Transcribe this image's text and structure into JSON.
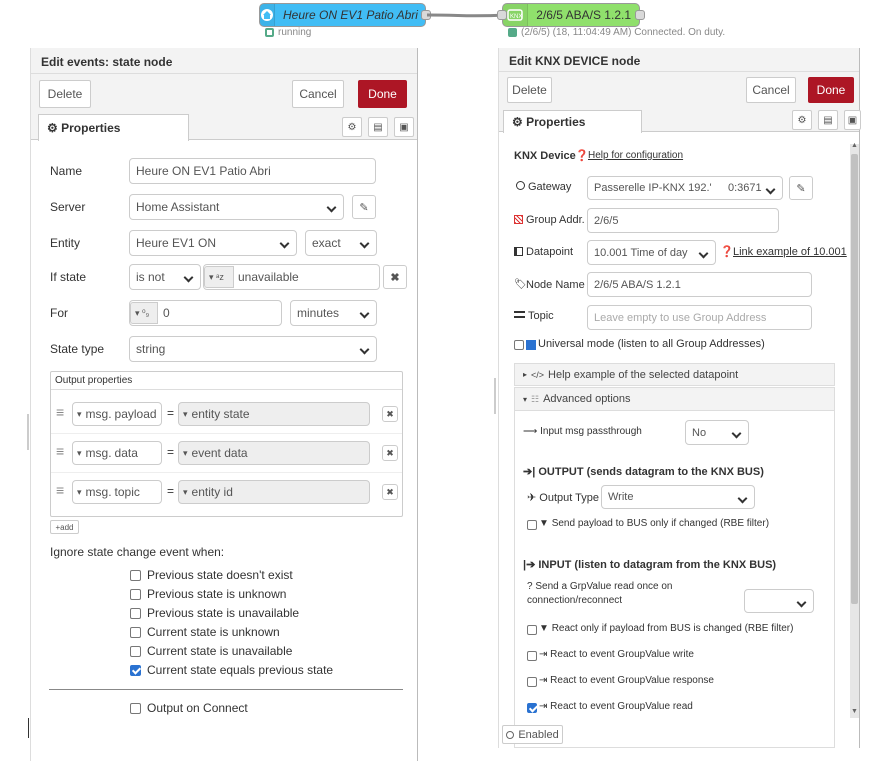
{
  "flow": {
    "node1_label": "Heure ON EV1 Patio Abri",
    "node1_status": "running",
    "node2_label": "2/6/5 ABA/S 1.2.1",
    "node2_status": "(2/6/5) (18, 11:04:49 AM) Connected. On duty.",
    "node1_color": "#41bdf5",
    "node2_color": "#90e06c"
  },
  "left": {
    "title": "Edit events: state node",
    "delete_label": "Delete",
    "cancel_label": "Cancel",
    "done_label": "Done",
    "tab_label": "Properties",
    "name_label": "Name",
    "name_value": "Heure ON EV1 Patio Abri",
    "server_label": "Server",
    "server_value": "Home Assistant",
    "entity_label": "Entity",
    "entity_value": "Heure EV1 ON",
    "entity_match": "exact",
    "ifstate_label": "If state",
    "ifstate_op": "is not",
    "ifstate_type": "a z",
    "ifstate_value": "unavailable",
    "for_label": "For",
    "for_type": "0 9",
    "for_value": "0",
    "for_unit": "minutes",
    "statetype_label": "State type",
    "statetype_value": "string",
    "output_props_label": "Output properties",
    "outputs": [
      {
        "prefix": "msg.",
        "prop": "payload",
        "value": "entity state"
      },
      {
        "prefix": "msg.",
        "prop": "data",
        "value": "event data"
      },
      {
        "prefix": "msg.",
        "prop": "topic",
        "value": "entity id"
      }
    ],
    "add_label": "add",
    "ignore_label": "Ignore state change event when:",
    "ignore_opts": [
      {
        "label": "Previous state doesn't exist",
        "checked": false
      },
      {
        "label": "Previous state is unknown",
        "checked": false
      },
      {
        "label": "Previous state is unavailable",
        "checked": false
      },
      {
        "label": "Current state is unknown",
        "checked": false
      },
      {
        "label": "Current state is unavailable",
        "checked": false
      },
      {
        "label": "Current state equals previous state",
        "checked": true
      }
    ],
    "output_connect_label": "Output on Connect"
  },
  "right": {
    "title": "Edit KNX DEVICE node",
    "delete_label": "Delete",
    "cancel_label": "Cancel",
    "done_label": "Done",
    "tab_label": "Properties",
    "knx_device_label": "KNX Device",
    "help_config_link": "Help for configuration",
    "gateway_label": "Gateway",
    "gateway_value": "Passerelle IP-KNX 192.'",
    "gateway_port": "0:3671",
    "group_addr_label": "Group Addr.",
    "group_addr_value": "2/6/5",
    "datapoint_label": "Datapoint",
    "datapoint_value": "10.001 Time of day",
    "datapoint_link": "Link example of 10.001",
    "node_name_label": "Node Name",
    "node_name_value": "2/6/5 ABA/S 1.2.1",
    "topic_label": "Topic",
    "topic_placeholder": "Leave empty to use Group Address",
    "universal_label": "Universal mode (listen to all Group Addresses)",
    "help_example_label": "Help example of the selected datapoint",
    "advanced_label": "Advanced options",
    "passthrough_label": "Input msg passthrough",
    "passthrough_value": "No",
    "output_header": "OUTPUT (sends datagram to the KNX BUS)",
    "output_type_label": "Output Type",
    "output_type_value": "Write",
    "rbe_out_label": "Send payload to BUS only if changed (RBE filter)",
    "input_header": "INPUT (listen to datagram from the KNX BUS)",
    "grpvalue_read_label_1": "Send a GrpValue read once on",
    "grpvalue_read_label_2": "connection/reconnect",
    "rbe_in_label": "React only if payload from BUS is changed (RBE filter)",
    "react_write_label": "React to event GroupValue write",
    "react_response_label": "React to event GroupValue response",
    "react_read_label": "React to event GroupValue read",
    "react_read_checked": true,
    "enabled_label": "Enabled"
  }
}
